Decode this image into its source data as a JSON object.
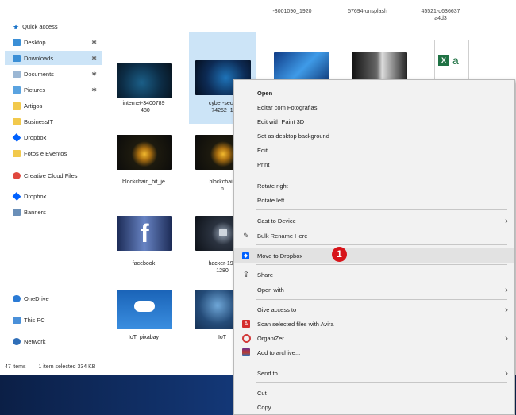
{
  "sidebar": {
    "items": [
      {
        "label": "Quick access",
        "icon": "star-icon",
        "pinned": false
      },
      {
        "label": "Desktop",
        "icon": "desktop-folder-icon",
        "pinned": true
      },
      {
        "label": "Downloads",
        "icon": "downloads-folder-icon",
        "pinned": true,
        "selected": true
      },
      {
        "label": "Documents",
        "icon": "documents-folder-icon",
        "pinned": true
      },
      {
        "label": "Pictures",
        "icon": "pictures-folder-icon",
        "pinned": true
      },
      {
        "label": "Artigos",
        "icon": "folder-icon",
        "pinned": false
      },
      {
        "label": "BusinessIT",
        "icon": "folder-icon",
        "pinned": false
      },
      {
        "label": "Dropbox",
        "icon": "dropbox-icon",
        "pinned": false
      },
      {
        "label": "Fotos e Eventos",
        "icon": "folder-icon",
        "pinned": false
      },
      {
        "label": "Creative Cloud Files",
        "icon": "creative-cloud-icon",
        "pinned": false
      },
      {
        "label": "Dropbox",
        "icon": "dropbox-icon",
        "pinned": false
      },
      {
        "label": "Banners",
        "icon": "banners-icon",
        "pinned": false
      },
      {
        "label": "OneDrive",
        "icon": "onedrive-icon",
        "pinned": false
      },
      {
        "label": "This PC",
        "icon": "this-pc-icon",
        "pinned": false
      },
      {
        "label": "Network",
        "icon": "network-icon",
        "pinned": false
      }
    ],
    "pin_glyph": "✱"
  },
  "status": {
    "count": "47 items",
    "selection": "1 item selected 334 KB"
  },
  "files": {
    "top_labels": [
      "-3001090_1920",
      "57694-unsplash",
      "45521-d636637\na4d3"
    ],
    "tiles": [
      {
        "label": "internet-3400789\n_480"
      },
      {
        "label": "cyber-secu\n74252_1"
      },
      {
        "label": ""
      },
      {
        "label": ""
      },
      {
        "label": ""
      },
      {
        "label": "blockchain_bit_je"
      },
      {
        "label": "blockchain\nn"
      },
      {
        "label": "facebook"
      },
      {
        "label": "hacker-194\n1280"
      },
      {
        "label": "IoT_pixabay"
      },
      {
        "label": "IoT"
      }
    ],
    "excel_letters": [
      "X",
      "a"
    ],
    "facebook_letter": "f"
  },
  "context_menu": {
    "items": [
      {
        "label": "Open"
      },
      {
        "label": "Editar com Fotografias"
      },
      {
        "label": "Edit with Paint 3D"
      },
      {
        "label": "Set as desktop background"
      },
      {
        "label": "Edit"
      },
      {
        "label": "Print"
      },
      {
        "label": "Rotate right"
      },
      {
        "label": "Rotate left"
      },
      {
        "label": "Cast to Device",
        "submenu": true
      },
      {
        "label": "Bulk Rename Here",
        "icon": "rename-icon"
      },
      {
        "label": "Move to Dropbox",
        "icon": "dropbox-icon"
      },
      {
        "label": "Share",
        "icon": "share-icon"
      },
      {
        "label": "Open with",
        "submenu": true
      },
      {
        "label": "Give access to",
        "submenu": true
      },
      {
        "label": "Scan selected files with Avira",
        "icon": "avira-icon"
      },
      {
        "label": "OrganiZer",
        "icon": "organizer-icon",
        "submenu": true
      },
      {
        "label": "Add to archive...",
        "icon": "winrar-icon"
      },
      {
        "label": "Send to",
        "submenu": true
      },
      {
        "label": "Cut"
      },
      {
        "label": "Copy"
      }
    ],
    "submenu_arrow": "›",
    "callout_number": "1"
  },
  "colors": {
    "selection": "#cce4f7",
    "callout": "#d7141a",
    "dropbox": "#0061fe"
  }
}
